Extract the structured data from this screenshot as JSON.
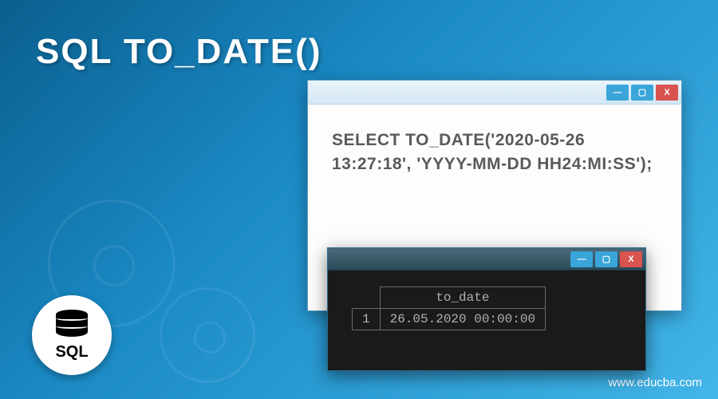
{
  "title": "SQL TO_DATE()",
  "sql_badge": {
    "label": "SQL"
  },
  "code_window": {
    "content": "SELECT TO_DATE('2020-05-26 13:27:18', 'YYYY-MM-DD HH24:MI:SS');",
    "buttons": {
      "minimize": "—",
      "maximize": "▢",
      "close": "X"
    }
  },
  "result_window": {
    "column_header": "to_date",
    "row_number": "1",
    "value": "26.05.2020 00:00:00",
    "buttons": {
      "minimize": "—",
      "maximize": "▢",
      "close": "X"
    }
  },
  "watermark": "www.educba.com"
}
